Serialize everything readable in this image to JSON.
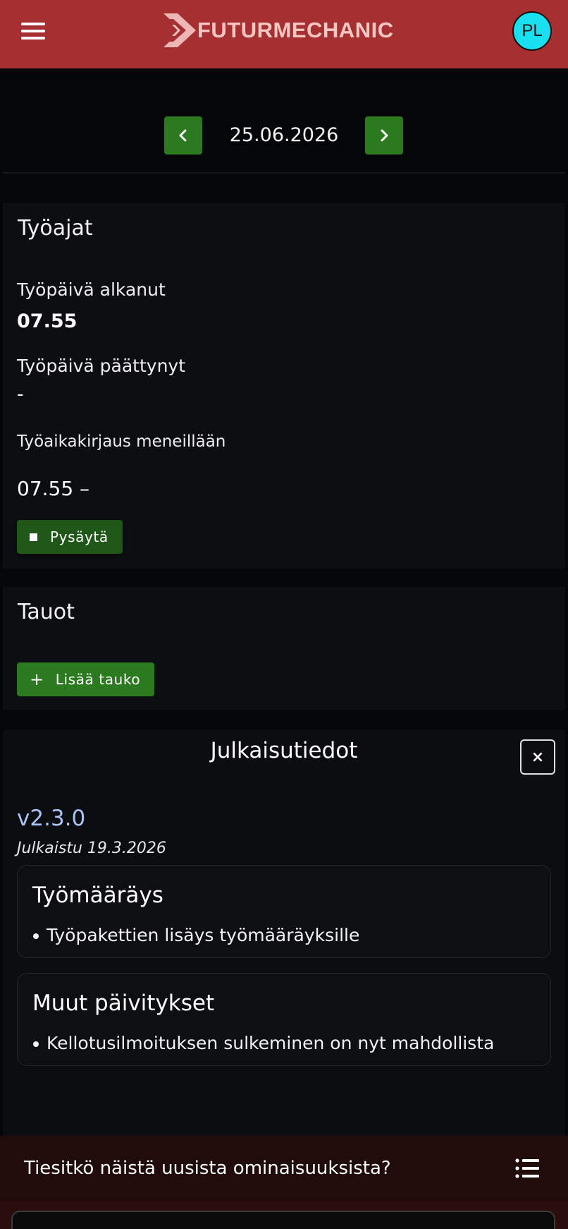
{
  "header": {
    "logo_text": "FUTURMECHANIC",
    "avatar_initials": "PL",
    "avatar_color": "#18e0f0",
    "brand_color": "#a52f31"
  },
  "date_nav": {
    "date": "25.06.2026",
    "prev_icon": "chevron-left-icon",
    "next_icon": "chevron-right-icon"
  },
  "work_times": {
    "title": "Työajat",
    "started_label": "Työpäivä alkanut",
    "started_value": "07.55",
    "ended_label": "Työpäivä päättynyt",
    "ended_value": "-",
    "ongoing_label": "Työaikakirjaus meneillään",
    "ongoing_range": "07.55 –",
    "stop_button": "Pysäytä"
  },
  "breaks": {
    "title": "Tauot",
    "add_button": "Lisää tauko"
  },
  "release_notes": {
    "title": "Julkaisutiedot",
    "close_label": "×",
    "version": "v2.3.0",
    "published": "Julkaistu 19.3.2026",
    "sections": [
      {
        "heading": "Työmääräys",
        "items": [
          "Työpakettien lisäys työmääräyksille"
        ]
      },
      {
        "heading": "Muut päivitykset",
        "items": [
          "Kellotusilmoituksen sulkeminen on nyt mahdollista"
        ]
      }
    ]
  },
  "banner": {
    "text": "Tiesitkö näistä uusista ominaisuuksista?",
    "icon": "list-icon"
  },
  "colors": {
    "accent_green": "#2c7a1f",
    "version_blue": "#a9c4f5"
  }
}
